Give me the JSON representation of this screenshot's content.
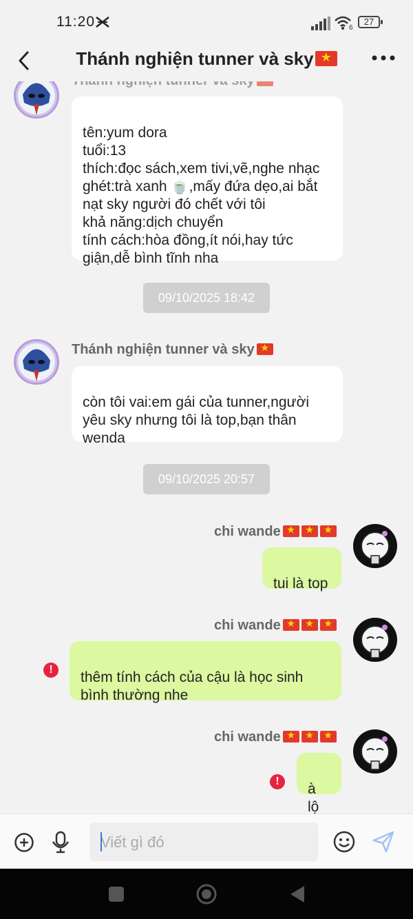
{
  "status_bar": {
    "time": "11:20",
    "battery": "27"
  },
  "header": {
    "title": "Thánh nghiện tunner và sky",
    "title_flag": "vietnam-flag"
  },
  "messages": [
    {
      "direction": "incoming",
      "sender": "Thánh nghiện tunner và sky",
      "text": "tên:yum dora\ntuổi:13\nthích:đọc sách,xem tivi,vẽ,nghe nhạc\nghét:trà xanh 🍵,mấy đứa dẹo,ai bắt nạt sky người đó chết với tôi\nkhả năng:dịch chuyển\ntính cách:hòa đồng,ít nói,hay tức giận,dễ bình tĩnh nha"
    },
    {
      "type": "timestamp",
      "text": "09/10/2025 18:42"
    },
    {
      "direction": "incoming",
      "sender": "Thánh nghiện tunner và sky",
      "text": "còn tôi vai:em gái của tunner,người yêu sky nhưng tôi là top,bạn thân wenda"
    },
    {
      "type": "timestamp",
      "text": "09/10/2025 20:57"
    },
    {
      "direction": "outgoing",
      "sender": "chi wande",
      "text": "tui là top",
      "error": false
    },
    {
      "direction": "outgoing",
      "sender": "chi wande",
      "text": "thêm tính cách của cậu là học sinh bình thường nhe",
      "error": true
    },
    {
      "direction": "outgoing",
      "sender": "chi wande",
      "text": "à lộ",
      "error": true
    }
  ],
  "input": {
    "placeholder": "Viết gì đó"
  },
  "colors": {
    "outgoing_bubble": "#dcf8a0",
    "incoming_bubble": "#ffffff",
    "error": "#e8233f",
    "send_icon": "#9fc3f5"
  }
}
